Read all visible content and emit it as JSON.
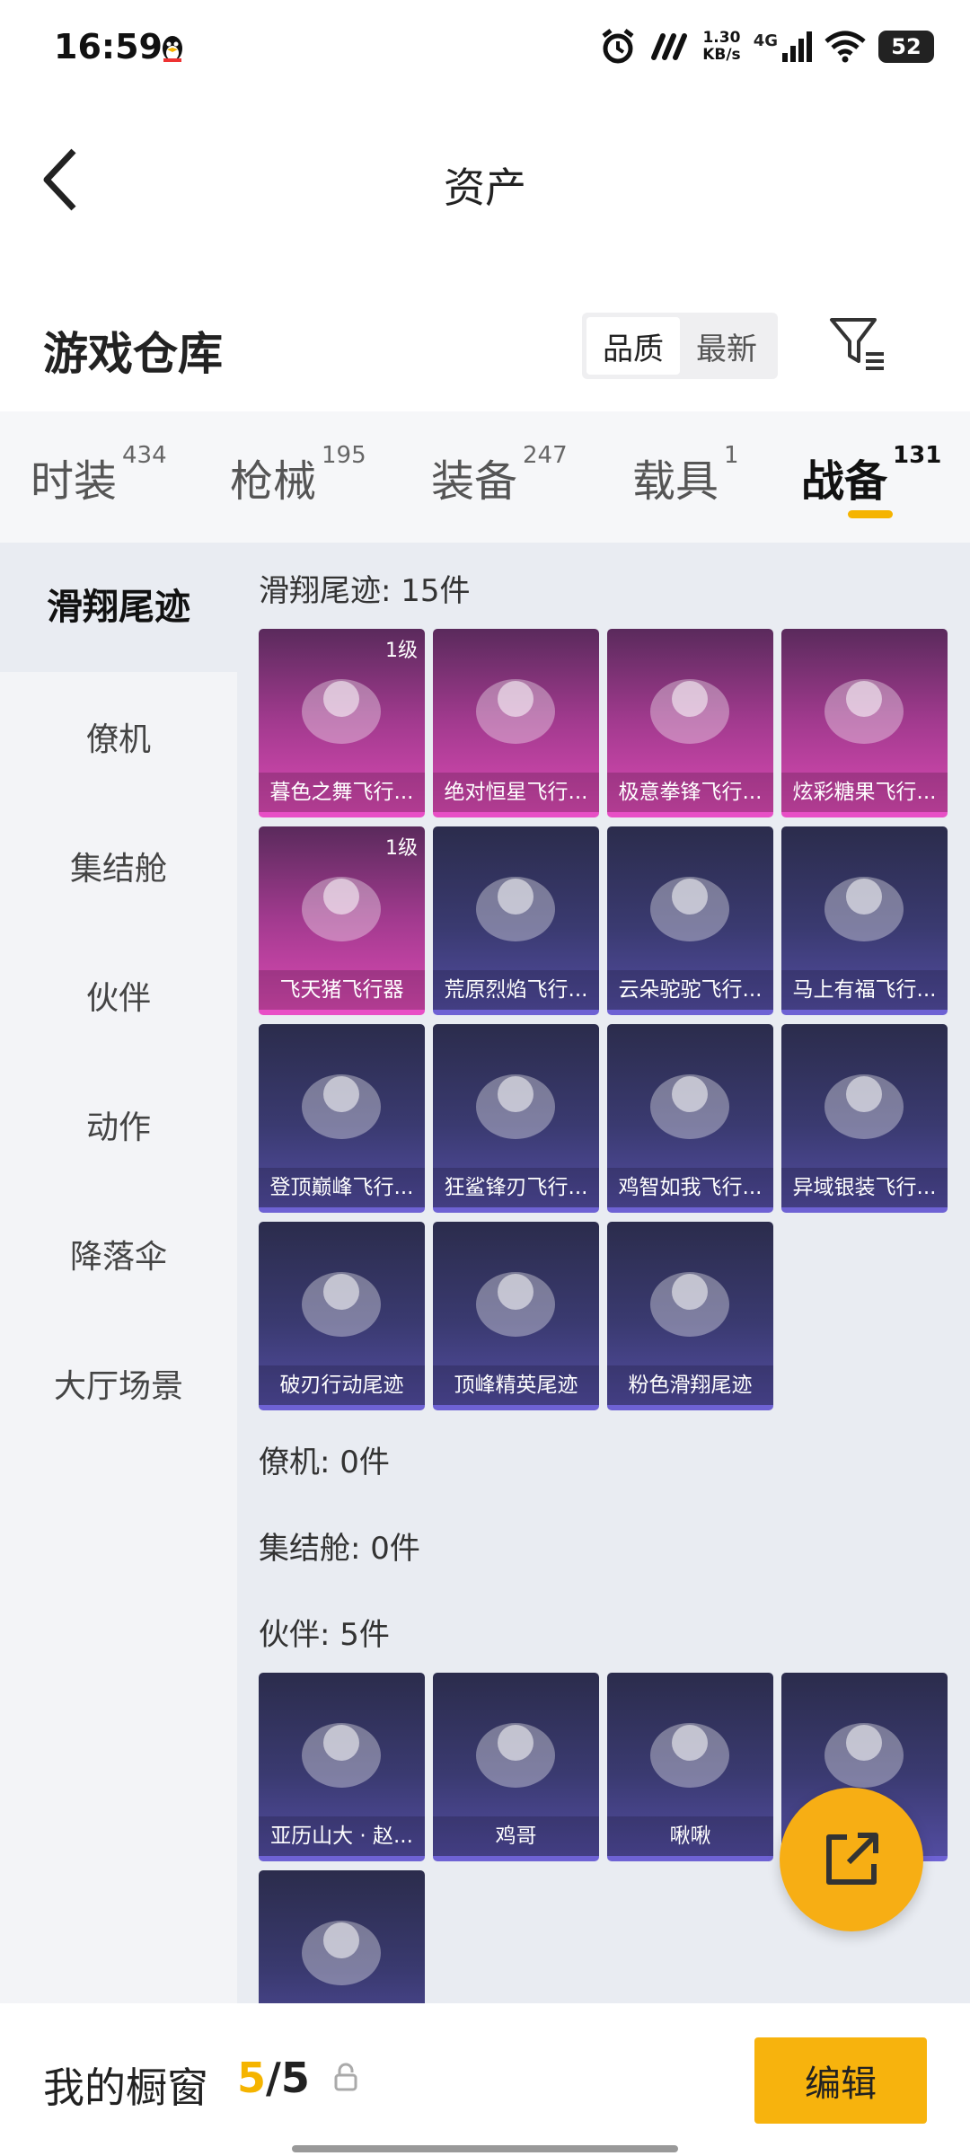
{
  "status": {
    "time": "16:59",
    "speed_value": "1.30",
    "speed_unit": "KB/s",
    "network": "4G",
    "battery": "52"
  },
  "nav": {
    "title": "资产"
  },
  "warehouse": {
    "title": "游戏仓库",
    "sort_options": [
      "品质",
      "最新"
    ],
    "active_sort": "品质"
  },
  "tabs": [
    {
      "label": "时装",
      "count": "434"
    },
    {
      "label": "枪械",
      "count": "195"
    },
    {
      "label": "装备",
      "count": "247"
    },
    {
      "label": "载具",
      "count": "1"
    },
    {
      "label": "战备",
      "count": "131"
    }
  ],
  "active_tab": "战备",
  "sidebar": {
    "items": [
      "滑翔尾迹",
      "僚机",
      "集结舱",
      "伙伴",
      "动作",
      "降落伞",
      "大厅场景"
    ],
    "active": "滑翔尾迹"
  },
  "sections": [
    {
      "title": "滑翔尾迹: 15件",
      "items": [
        {
          "name": "暮色之舞飞行...",
          "rarity": "pink",
          "level": "1级",
          "icon": "red-glider-icon"
        },
        {
          "name": "绝对恒星飞行...",
          "rarity": "pink",
          "icon": "pink-planet-glider-icon"
        },
        {
          "name": "极意拳锋飞行...",
          "rarity": "pink",
          "icon": "elephant-glider-icon"
        },
        {
          "name": "炫彩糖果飞行...",
          "rarity": "pink",
          "icon": "candy-glider-icon"
        },
        {
          "name": "飞天猪飞行器",
          "rarity": "pink",
          "level": "1级",
          "icon": "pig-glider-icon"
        },
        {
          "name": "荒原烈焰飞行...",
          "rarity": "purple",
          "icon": "red-mech-glider-icon"
        },
        {
          "name": "云朵驼驼飞行...",
          "rarity": "purple",
          "icon": "alpaca-glider-icon"
        },
        {
          "name": "马上有福飞行...",
          "rarity": "purple",
          "icon": "horse-glider-icon"
        },
        {
          "name": "登顶巅峰飞行...",
          "rarity": "purple",
          "icon": "jet-glider-icon"
        },
        {
          "name": "狂鲨锋刃飞行...",
          "rarity": "purple",
          "icon": "shark-glider-icon"
        },
        {
          "name": "鸡智如我飞行...",
          "rarity": "purple",
          "icon": "chicken-glider-icon"
        },
        {
          "name": "异域银装飞行...",
          "rarity": "purple",
          "icon": "teal-wing-glider-icon"
        },
        {
          "name": "破刃行动尾迹",
          "rarity": "purple",
          "icon": "rainbow-trail-icon"
        },
        {
          "name": "顶峰精英尾迹",
          "rarity": "purple",
          "icon": "blue-trail-icon"
        },
        {
          "name": "粉色滑翔尾迹",
          "rarity": "purple",
          "icon": "pink-trail-icon"
        }
      ]
    },
    {
      "title": "僚机: 0件",
      "items": []
    },
    {
      "title": "集结舱: 0件",
      "items": []
    },
    {
      "title": "伙伴: 5件",
      "items": [
        {
          "name": "亚历山大 · 赵...",
          "rarity": "purple",
          "icon": "tiger-companion-icon"
        },
        {
          "name": "鸡哥",
          "rarity": "purple",
          "icon": "rooster-companion-icon"
        },
        {
          "name": "啾啾",
          "rarity": "purple",
          "icon": "pink-bird-companion-icon"
        },
        {
          "name": "",
          "rarity": "purple",
          "icon": "white-chick-companion-icon"
        },
        {
          "name": "",
          "rarity": "purple",
          "icon": "helmet-chick-companion-icon"
        }
      ]
    }
  ],
  "bottom": {
    "label": "我的橱窗",
    "current": "5",
    "separator": "/",
    "total": "5",
    "edit_label": "编辑"
  },
  "colors": {
    "accent": "#f5b400",
    "pink_card": "#d949b2",
    "purple_card": "#524ca0"
  }
}
